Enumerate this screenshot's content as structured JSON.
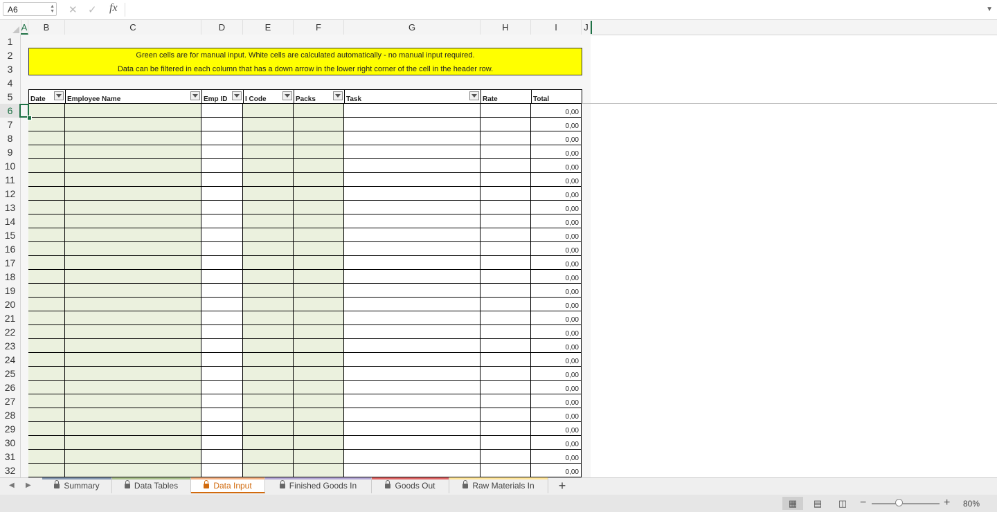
{
  "formula_bar": {
    "name_box": "A6",
    "cancel_icon": "close-icon",
    "enter_icon": "check-icon",
    "fx_label": "fx",
    "formula_value": ""
  },
  "columns": [
    "A",
    "B",
    "C",
    "D",
    "E",
    "F",
    "G",
    "H",
    "I",
    "J"
  ],
  "selected_column": "A",
  "rows": [
    "1",
    "2",
    "3",
    "4",
    "5",
    "6",
    "7",
    "8",
    "9",
    "10",
    "11",
    "12",
    "13",
    "14",
    "15",
    "16",
    "17",
    "18",
    "19",
    "20",
    "21",
    "22",
    "23",
    "24",
    "25",
    "26",
    "27",
    "28",
    "29",
    "30",
    "31",
    "32"
  ],
  "selected_row": "6",
  "banner": {
    "line1": "Green cells are for manual input.  White cells are calculated automatically - no manual input required.",
    "line2": "Data can be filtered in each column that has a down arrow in the lower right corner of the cell in the header row."
  },
  "table_headers": [
    {
      "label": "Date",
      "filter": true
    },
    {
      "label": "Employee Name",
      "filter": true
    },
    {
      "label": "Emp ID",
      "filter": true
    },
    {
      "label": "I Code",
      "filter": true
    },
    {
      "label": "Packs",
      "filter": true
    },
    {
      "label": "Task",
      "filter": true
    },
    {
      "label": "Rate",
      "filter": false
    },
    {
      "label": "Total",
      "filter": false
    }
  ],
  "total_value": "0,00",
  "colors": {
    "input_green": "#ebf1de",
    "banner_yellow": "#ffff00",
    "excel_green": "#1e7145",
    "active_tab": "#d16a0d"
  },
  "sheet_tabs": [
    {
      "label": "Summary",
      "locked": true,
      "color": "#8497b0"
    },
    {
      "label": "Data Tables",
      "locked": true,
      "color": "#a9c08c"
    },
    {
      "label": "Data Input",
      "locked": true,
      "color": "#f4b183",
      "active": true
    },
    {
      "label": "Finished Goods In",
      "locked": true,
      "color": "#b4a7d6"
    },
    {
      "label": "Goods Out",
      "locked": true,
      "color": "#e06666"
    },
    {
      "label": "Raw Materials In",
      "locked": true,
      "color": "#ffe599"
    }
  ],
  "add_sheet_label": "+",
  "status_bar": {
    "zoom_minus": "−",
    "zoom_plus": "+",
    "zoom_level": "80%"
  }
}
